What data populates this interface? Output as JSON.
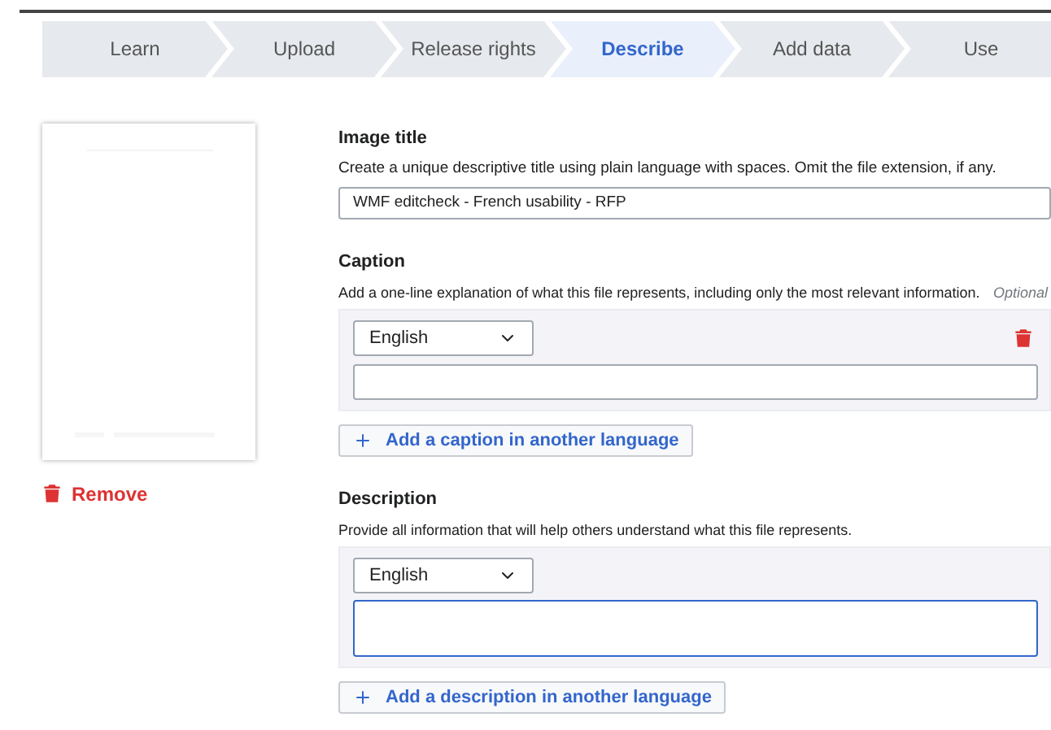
{
  "steps": [
    {
      "label": "Learn",
      "selected": false
    },
    {
      "label": "Upload",
      "selected": false
    },
    {
      "label": "Release rights",
      "selected": false
    },
    {
      "label": "Describe",
      "selected": true
    },
    {
      "label": "Add data",
      "selected": false
    },
    {
      "label": "Use",
      "selected": false
    }
  ],
  "thumbnail": {
    "kind": "picture",
    "remove_label": "Remove"
  },
  "image_title": {
    "heading": "Image title",
    "help": "Create a unique descriptive title using plain language with spaces. Omit the file extension, if any.",
    "value": "WMF editcheck - French usability - RFP"
  },
  "sections": [
    {
      "heading": "Caption",
      "help": "Add a one-line explanation of what this file represents, including only the most relevant information.",
      "optional": "Optional",
      "language": "English",
      "removable": true,
      "focused": false,
      "multiline": false,
      "add_button": "Add a caption in another language"
    },
    {
      "heading": "Description",
      "help": "Provide all information that will help others understand what this file represents.",
      "language": "English",
      "removable": false,
      "focused": true,
      "multiline": true,
      "add_button": "Add a description in another language"
    }
  ]
}
